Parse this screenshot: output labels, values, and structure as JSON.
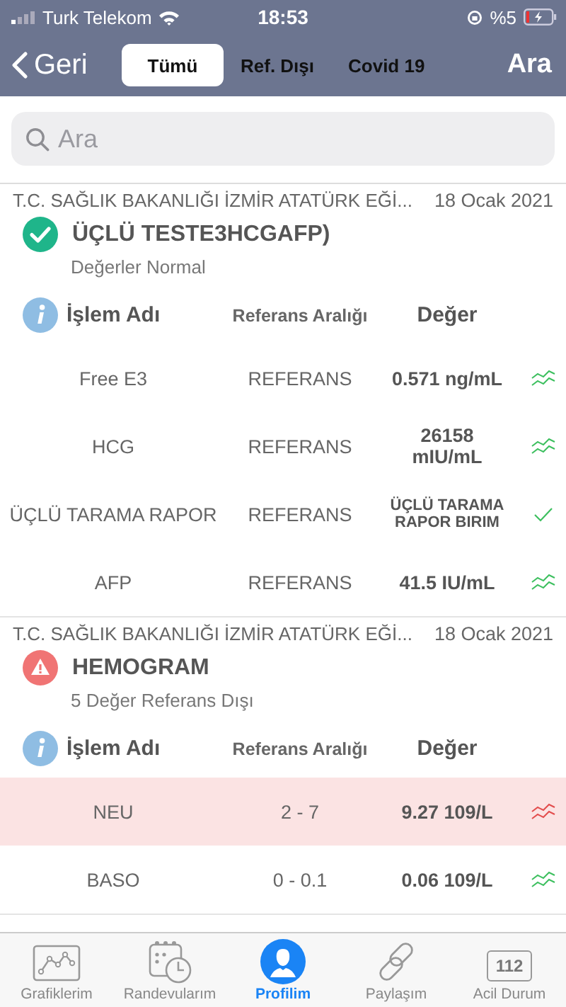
{
  "status_bar": {
    "carrier": "Turk Telekom",
    "time": "18:53",
    "battery": "%5"
  },
  "nav": {
    "back": "Geri",
    "action": "Ara",
    "tabs": [
      {
        "label": "Tümü",
        "selected": true
      },
      {
        "label": "Ref. Dışı",
        "selected": false
      },
      {
        "label": "Covid 19",
        "selected": false
      }
    ]
  },
  "search": {
    "placeholder": "Ara"
  },
  "groups": [
    {
      "hospital": "T.C. SAĞLIK BAKANLIĞI İZMİR ATATÜRK EĞİ...",
      "date": "18 Ocak 2021",
      "title": "ÜÇLÜ TESTE3HCGAFP)",
      "kind": "normal",
      "summary": "Değerler Normal",
      "columns": [
        "İşlem Adı",
        "Referans Aralığı",
        "Değer"
      ],
      "rows": [
        {
          "name": "Free E3",
          "range": "REFERANS",
          "value": "0.571 ng/mL",
          "kind": "chart",
          "out_of_range": false
        },
        {
          "name": "HCG",
          "range": "REFERANS",
          "value": "26158 mIU/mL",
          "kind": "chart",
          "out_of_range": false
        },
        {
          "name": "ÜÇLÜ TARAMA RAPOR",
          "range": "REFERANS",
          "value": "ÜÇLÜ TARAMA RAPOR BIRIM",
          "kind": "check",
          "out_of_range": false
        },
        {
          "name": "AFP",
          "range": "REFERANS",
          "value": "41.5 IU/mL",
          "kind": "chart",
          "out_of_range": false
        }
      ]
    },
    {
      "hospital": "T.C. SAĞLIK BAKANLIĞI İZMİR ATATÜRK EĞİ...",
      "date": "18 Ocak 2021",
      "title": "HEMOGRAM",
      "kind": "abnormal",
      "summary": "5 Değer Referans Dışı",
      "columns": [
        "İşlem Adı",
        "Referans Aralığı",
        "Değer"
      ],
      "rows": [
        {
          "name": "NEU",
          "range": "2 - 7",
          "value": "9.27 109/L",
          "kind": "chart",
          "out_of_range": true
        },
        {
          "name": "BASO",
          "range": "0 - 0.1",
          "value": "0.06 109/L",
          "kind": "chart",
          "out_of_range": false
        }
      ]
    }
  ],
  "tab_bar": [
    {
      "label": "Grafiklerim",
      "selected": false
    },
    {
      "label": "Randevularım",
      "selected": false
    },
    {
      "label": "Profilim",
      "selected": true
    },
    {
      "label": "Paylaşım",
      "selected": false
    },
    {
      "label": "Acil Durum",
      "selected": false,
      "badge": "112"
    }
  ]
}
